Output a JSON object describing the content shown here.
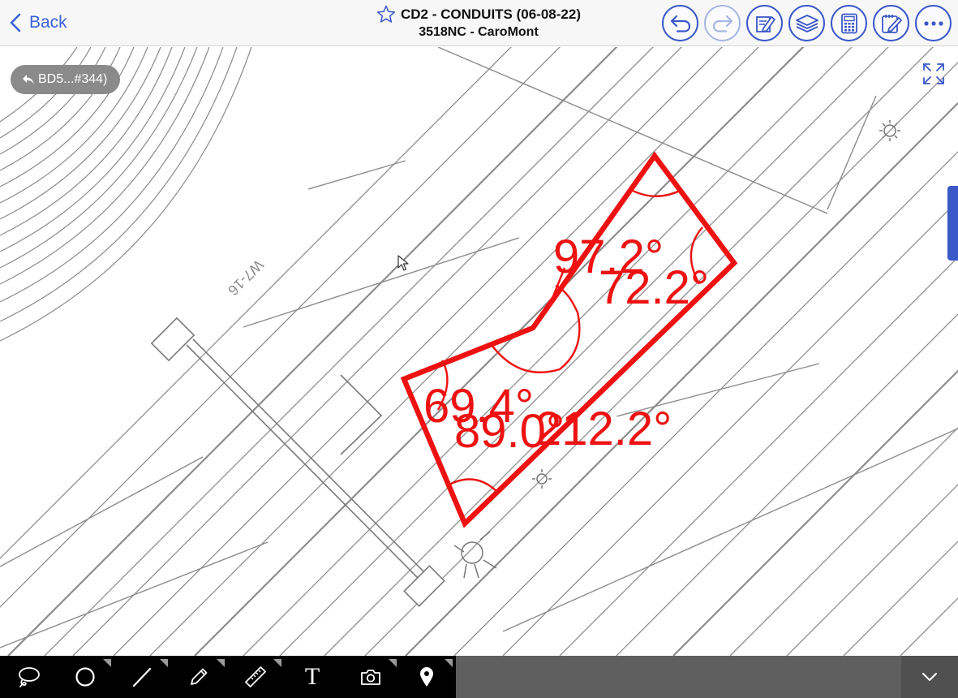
{
  "header": {
    "back_label": "Back",
    "title": "CD2 - CONDUITS (06-08-22)",
    "subtitle": "3518NC - CaroMont",
    "toolbar_icons": [
      "undo-icon",
      "redo-icon",
      "stamp-icon",
      "layers-icon",
      "calculator-icon",
      "notes-icon",
      "more-icon"
    ],
    "redo_enabled": false
  },
  "drawing": {
    "reference_pill": "BD5...#344)",
    "sheet_label": "W7-16",
    "angles": {
      "a1": "97.2°",
      "a2": "72.2°",
      "a3": "69.4°",
      "a4": "89.0°",
      "a5": "212.2°"
    },
    "markup_color": "#ee1111"
  },
  "bottom_toolbar": {
    "tools": [
      "lasso-icon",
      "circle-icon",
      "line-icon",
      "pencil-icon",
      "ruler-icon",
      "text-tool",
      "camera-icon",
      "location-pin-icon"
    ],
    "text_tool_label": "T"
  },
  "colors": {
    "accent": "#3a58c8",
    "link": "#3a62d8",
    "linework": "#8c8c8c"
  }
}
